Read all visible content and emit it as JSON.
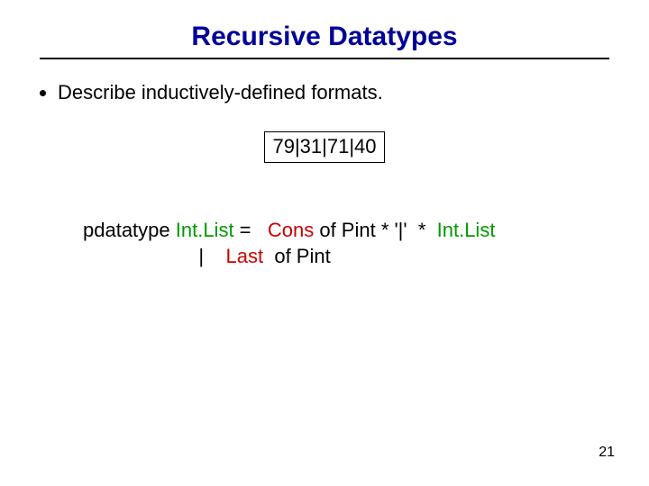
{
  "title": "Recursive Datatypes",
  "bullets": {
    "b1": "Describe inductively-defined formats."
  },
  "example": "79|31|71|40",
  "code": {
    "kw_pdatatype": "pdatatype ",
    "ty_intlist_a": "Int.List",
    "eq": " =   ",
    "ctor_cons": "Cons",
    "cons_rest_a": " of Pint * '|'  *  ",
    "ty_intlist_b": "Int.List",
    "row2_indent": "                     |    ",
    "ctor_last": "Last ",
    "last_rest": " of Pint"
  },
  "page": "21"
}
